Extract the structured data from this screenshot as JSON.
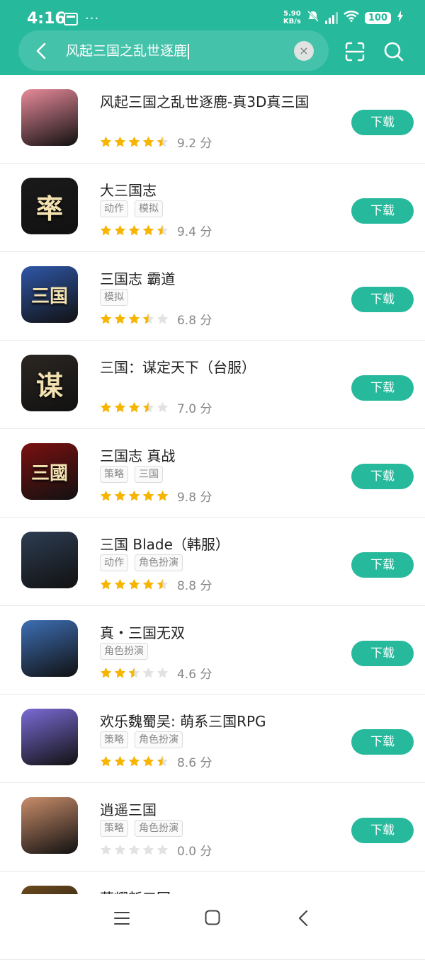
{
  "status_bar": {
    "time": "4:16",
    "net_speed_value": "5.90",
    "net_speed_unit": "KB/s",
    "battery": "100"
  },
  "search": {
    "query": "风起三国之乱世逐鹿"
  },
  "download_label": "下载",
  "score_unit": "分",
  "apps": [
    {
      "name": "风起三国之乱世逐鹿-真3D真三国",
      "tags": [],
      "rating": 4.5,
      "score": "9.2",
      "icon": "warrior-girl-icon",
      "bg": "#e88a9a"
    },
    {
      "name": "大三国志",
      "tags": [
        "动作",
        "模拟"
      ],
      "rating": 4.5,
      "score": "9.4",
      "icon": "shuai-calligraphy-icon",
      "bg": "#1a1a1a"
    },
    {
      "name": "三国志 霸道",
      "tags": [
        "模拟"
      ],
      "rating": 3.5,
      "score": "6.8",
      "icon": "sanguozhi-badao-icon",
      "bg": "#2f57a8"
    },
    {
      "name": "三国：谋定天下（台服）",
      "tags": [],
      "rating": 3.5,
      "score": "7.0",
      "icon": "mou-calligraphy-icon",
      "bg": "#2b2622"
    },
    {
      "name": "三国志 真战",
      "tags": [
        "策略",
        "三国"
      ],
      "rating": 5,
      "score": "9.8",
      "icon": "sanguozhi-zhenzhan-icon",
      "bg": "#7a1010"
    },
    {
      "name": "三国 Blade（韩服）",
      "tags": [
        "动作",
        "角色扮演"
      ],
      "rating": 4.5,
      "score": "8.8",
      "icon": "bearded-warrior-icon",
      "bg": "#2d3d52"
    },
    {
      "name": "真・三国无双",
      "tags": [
        "角色扮演"
      ],
      "rating": 2.5,
      "score": "4.6",
      "icon": "headband-hero-icon",
      "bg": "#3d6fb5"
    },
    {
      "name": "欢乐魏蜀吴: 萌系三国RPG",
      "tags": [
        "策略",
        "角色扮演"
      ],
      "rating": 4.5,
      "score": "8.6",
      "icon": "anime-girl-icon",
      "bg": "#7a6bd6"
    },
    {
      "name": "逍遥三国",
      "tags": [
        "策略",
        "角色扮演"
      ],
      "rating": 0,
      "score": "0.0",
      "icon": "lady-portrait-icon",
      "bg": "#c98d6a"
    },
    {
      "name": "荣耀新三国",
      "tags": [],
      "rating": null,
      "score": null,
      "icon": "golden-emblem-icon",
      "bg": "#6b4a1e"
    }
  ],
  "colors": {
    "accent": "#27b99c",
    "star_filled": "#f7b500",
    "star_empty": "#e2e2e2"
  }
}
